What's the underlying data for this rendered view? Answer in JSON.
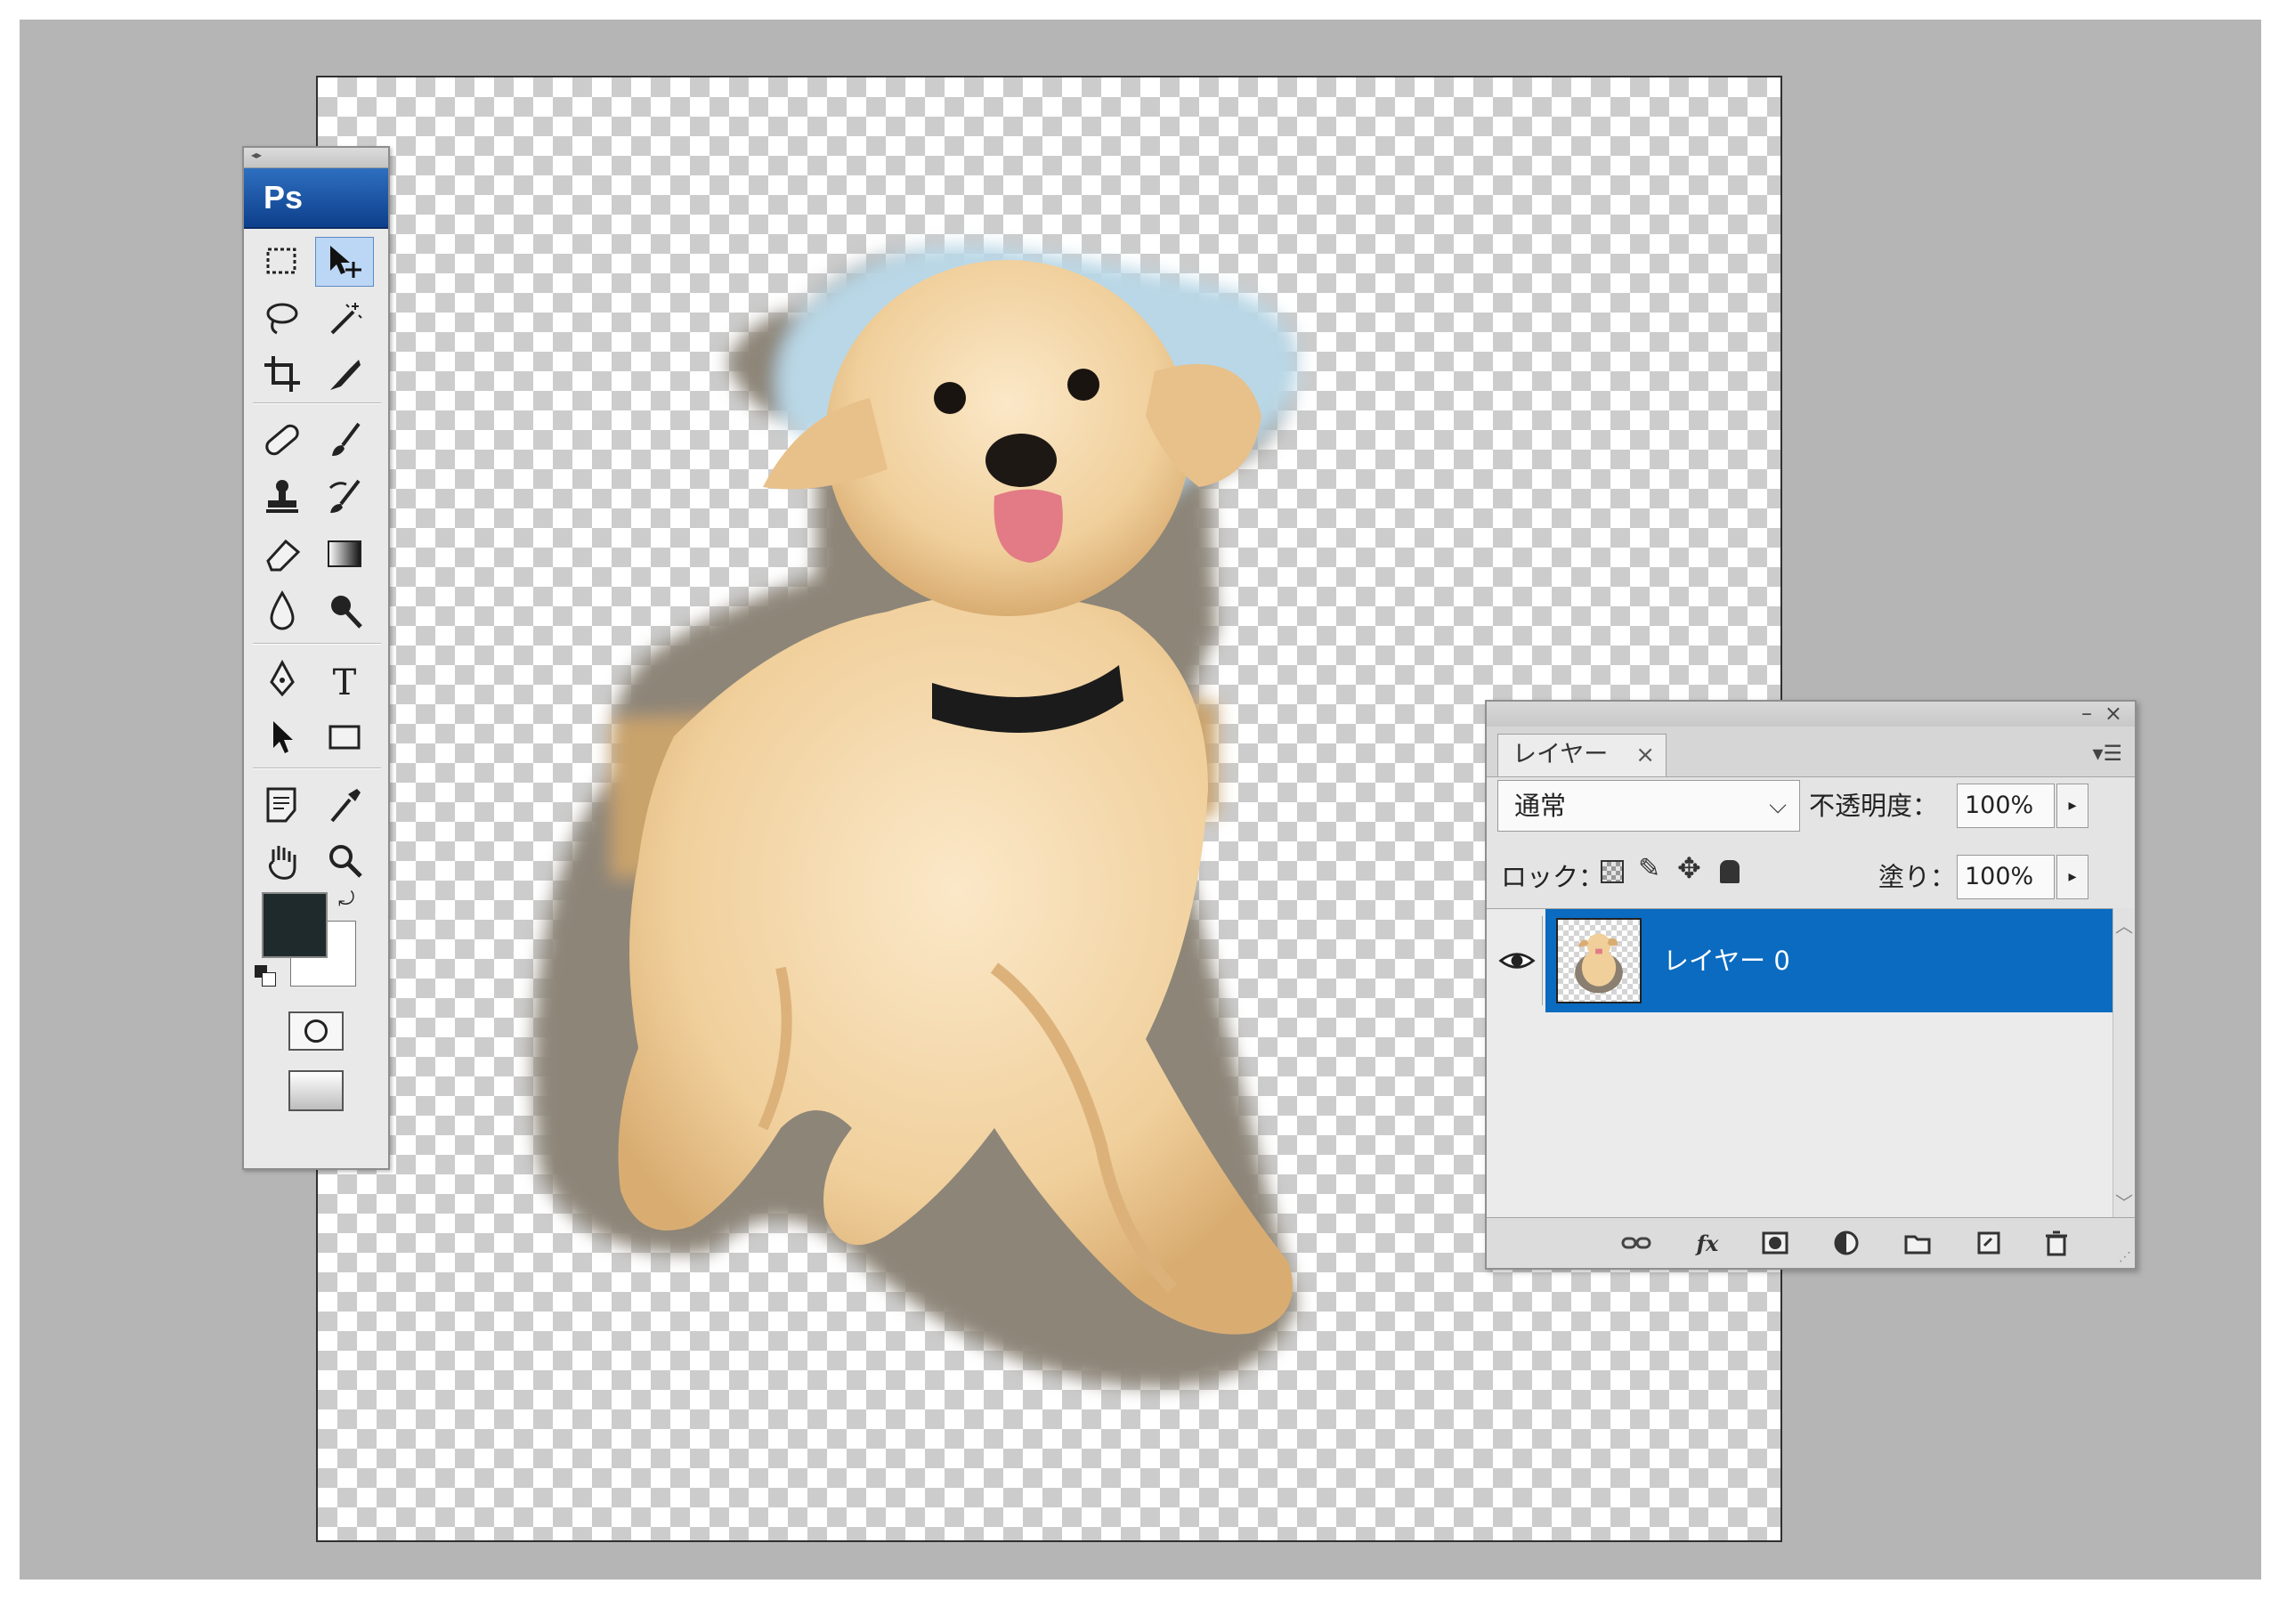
{
  "app": {
    "logo": "Ps"
  },
  "tools": {
    "items": [
      "marquee-tool",
      "move-tool",
      "lasso-tool",
      "magic-wand-tool",
      "crop-tool",
      "slice-tool",
      "healing-brush-tool",
      "brush-tool",
      "clone-stamp-tool",
      "history-brush-tool",
      "eraser-tool",
      "gradient-tool",
      "blur-tool",
      "dodge-tool",
      "pen-tool",
      "type-tool",
      "path-selection-tool",
      "rectangle-tool",
      "notes-tool",
      "eyedropper-tool",
      "hand-tool",
      "zoom-tool"
    ],
    "active": "move-tool",
    "foreground_color": "#1f2a2c",
    "background_color": "#ffffff"
  },
  "layers_panel": {
    "tab_label": "レイヤー",
    "tab_close": "×",
    "blend_mode": "通常",
    "opacity_label": "不透明度：",
    "opacity_value": "100%",
    "lock_label": "ロック：",
    "fill_label": "塗り：",
    "fill_value": "100%",
    "layers": [
      {
        "name": "レイヤー 0",
        "visible": true,
        "selected": true
      }
    ],
    "selection_color": "#0a6bc0"
  }
}
